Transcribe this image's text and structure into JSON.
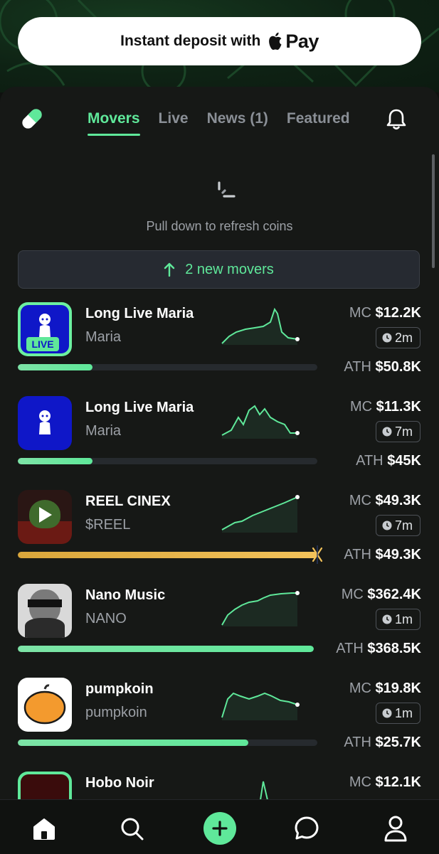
{
  "deposit": {
    "label": "Instant deposit with",
    "pay_label": "Pay",
    "icon": "apple-icon"
  },
  "tabs": [
    {
      "label": "Movers",
      "active": true
    },
    {
      "label": "Live",
      "active": false
    },
    {
      "label": "News (1)",
      "active": false
    },
    {
      "label": "Featured",
      "active": false
    }
  ],
  "refresh": {
    "text": "Pull down to refresh coins"
  },
  "new_movers": {
    "label": "2 new movers"
  },
  "colors": {
    "accent": "#5fe89a",
    "background": "#161816",
    "gold": "#f3c25a"
  },
  "coins": [
    {
      "name": "Long Live Maria",
      "ticker": "Maria",
      "mc_label": "MC",
      "mc_value": "$12.2K",
      "age": "2m",
      "ath_label": "ATH",
      "ath_value": "$50.8K",
      "badge": "LIVE",
      "progress": 0.25
    },
    {
      "name": "Long Live Maria",
      "ticker": "Maria",
      "mc_label": "MC",
      "mc_value": "$11.3K",
      "age": "7m",
      "ath_label": "ATH",
      "ath_value": "$45K",
      "progress": 0.25
    },
    {
      "name": "REEL CINEX",
      "ticker": "$REEL",
      "mc_label": "MC",
      "mc_value": "$49.3K",
      "age": "7m",
      "ath_label": "ATH",
      "ath_value": "$49.3K",
      "progress": 1.0
    },
    {
      "name": "Nano Music",
      "ticker": "NANO",
      "mc_label": "MC",
      "mc_value": "$362.4K",
      "age": "1m",
      "ath_label": "ATH",
      "ath_value": "$368.5K",
      "progress": 0.98
    },
    {
      "name": "pumpkoin",
      "ticker": "pumpkoin",
      "mc_label": "MC",
      "mc_value": "$19.8K",
      "age": "1m",
      "ath_label": "ATH",
      "ath_value": "$25.7K",
      "progress": 0.77
    },
    {
      "name": "Hobo Noir",
      "mc_label": "MC",
      "mc_value": "$12.1K"
    }
  ],
  "nav": [
    "home-icon",
    "search-icon",
    "plus-icon",
    "chat-icon",
    "profile-icon"
  ]
}
